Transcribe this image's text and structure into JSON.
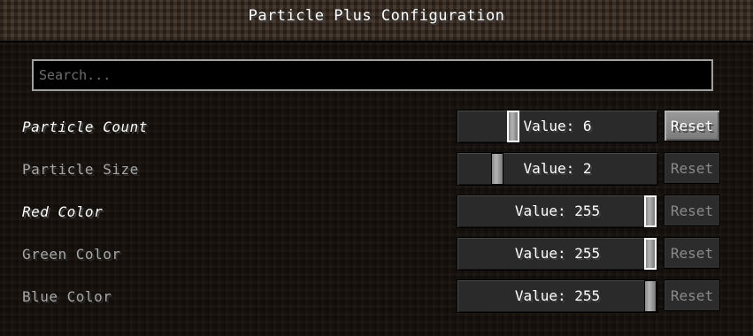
{
  "header": {
    "title": "Particle Plus Configuration"
  },
  "search": {
    "placeholder": "Search...",
    "value": ""
  },
  "options": [
    {
      "label": "Particle Count",
      "value_text": "Value: 6",
      "level": 0.28,
      "reset_label": "Reset",
      "reset_enabled": true,
      "changed": true
    },
    {
      "label": "Particle Size",
      "value_text": "Value: 2",
      "level": 0.19,
      "reset_label": "Reset",
      "reset_enabled": false,
      "changed": false
    },
    {
      "label": "Red Color",
      "value_text": "Value: 255",
      "level": 1.0,
      "reset_label": "Reset",
      "reset_enabled": false,
      "changed": true
    },
    {
      "label": "Green Color",
      "value_text": "Value: 255",
      "level": 1.0,
      "reset_label": "Reset",
      "reset_enabled": false,
      "changed": false
    },
    {
      "label": "Blue Color",
      "value_text": "Value: 255",
      "level": 1.0,
      "reset_label": "Reset",
      "reset_enabled": false,
      "changed": false
    }
  ]
}
